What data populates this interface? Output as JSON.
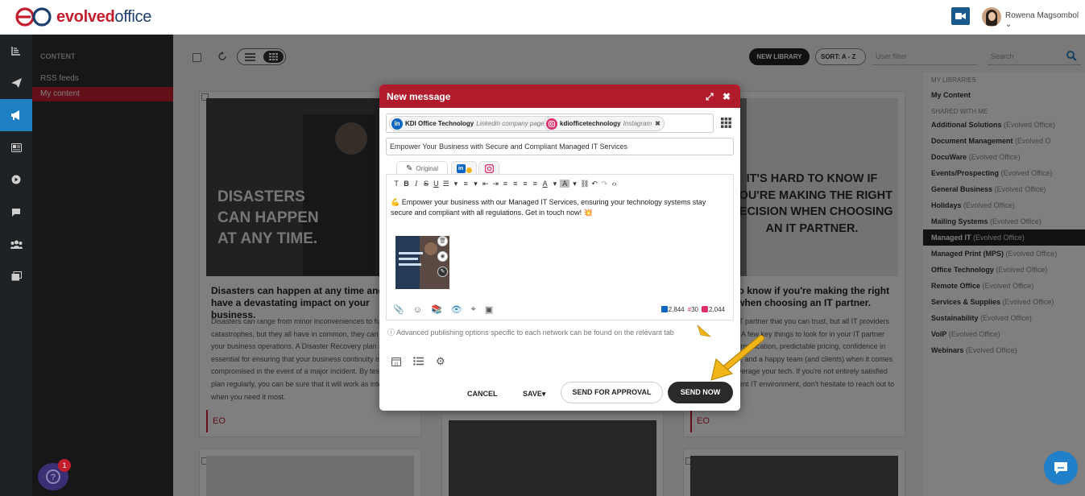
{
  "header": {
    "logo_text_a": "evolved",
    "logo_text_b": "office",
    "user_name": "Rowena Magsombol"
  },
  "subnav": {
    "heading": "CONTENT",
    "items": [
      {
        "label": "RSS feeds"
      },
      {
        "label": "My content"
      }
    ]
  },
  "toolbar": {
    "new_library": "NEW LIBRARY",
    "sort": "SORT: A - Z",
    "user_filter_placeholder": "User filter",
    "search_placeholder": "Search"
  },
  "cards": [
    {
      "image_text": "DISASTERS CAN HAPPEN AT ANY TIME.",
      "title": "Disasters can happen at any time and can have a devastating impact on your business.",
      "body": "Disasters can range from minor inconveniences to full catastrophes, but they all have in common, they can disrupt your business operations. A Disaster Recovery plan is essential for ensuring that your business continuity is not compromised in the event of a major incident. By testing your plan regularly, you can be sure that it will work as intended when you need it most.",
      "tag": "EO"
    },
    {
      "image_text": "IT'S HARD TO KNOW IF YOU'RE MAKING THE RIGHT DECISION WHEN CHOOSING AN IT PARTNER.",
      "title": "It's hard to know if you're making the right decision when choosing an IT partner.",
      "body": "You want an IT partner that you can trust, but all IT providers are not equal. A few key things to look for in your IT partner are: easy communication, predictable pricing, confidence in their expertise, and a happy team (and clients) when it comes to how you leverage your tech. If you're not entirely satisfied with your current IT environment, don't hesitate to reach out to us. There [...]",
      "tag": "EO"
    }
  ],
  "libraries": {
    "my_heading": "MY LIBRARIES",
    "my_content": "My Content",
    "shared_heading": "SHARED WITH ME",
    "items": [
      {
        "name": "Additional Solutions",
        "owner": "(Evolved Office)"
      },
      {
        "name": "Document Management",
        "owner": "(Evolved O"
      },
      {
        "name": "DocuWare",
        "owner": "(Evolved Office)"
      },
      {
        "name": "Events/Prospecting",
        "owner": "(Evolved Office)"
      },
      {
        "name": "General Business",
        "owner": "(Evolved Office)"
      },
      {
        "name": "Holidays",
        "owner": "(Evolved Office)"
      },
      {
        "name": "Mailing Systems",
        "owner": "(Evolved Office)"
      },
      {
        "name": "Managed IT",
        "owner": "(Evolved Office)"
      },
      {
        "name": "Managed Print (MPS)",
        "owner": "(Evolved Office)"
      },
      {
        "name": "Office Technology",
        "owner": "(Evolved Office)"
      },
      {
        "name": "Remote Office",
        "owner": "(Evolved Office)"
      },
      {
        "name": "Services & Supplies",
        "owner": "(Evolved Office)"
      },
      {
        "name": "Sustainability",
        "owner": "(Evolved Office)"
      },
      {
        "name": "VoIP",
        "owner": "(Evolved Office)"
      },
      {
        "name": "Webinars",
        "owner": "(Evolved Office)"
      }
    ]
  },
  "help_badge": "1",
  "modal": {
    "title": "New message",
    "recipients": [
      {
        "name": "KDI Office Technology",
        "type": "Linkedin company page"
      },
      {
        "name": "kdiofficetechnology",
        "type": "Instagram"
      }
    ],
    "subject": "Empower Your Business with Secure and Compliant Managed IT Services",
    "tab_original": "Original",
    "message": "Empower your business with our Managed IT Services, ensuring your technology systems stay secure and compliant with all regulations. Get in touch now!",
    "counts": {
      "linkedin": "2,844",
      "hash": "30",
      "instagram": "2,044"
    },
    "advanced_note": "Advanced publishing options specific to each network can be found on the relevant tab",
    "buttons": {
      "cancel": "CANCEL",
      "save": "SAVE",
      "send_for_approval": "SEND FOR APPROVAL",
      "send_now": "SEND NOW"
    }
  },
  "colors": {
    "brand_red": "#b01c2b",
    "linkedin": "#0a66c2",
    "instagram": "#e1306c",
    "annotation": "#f2b519"
  }
}
